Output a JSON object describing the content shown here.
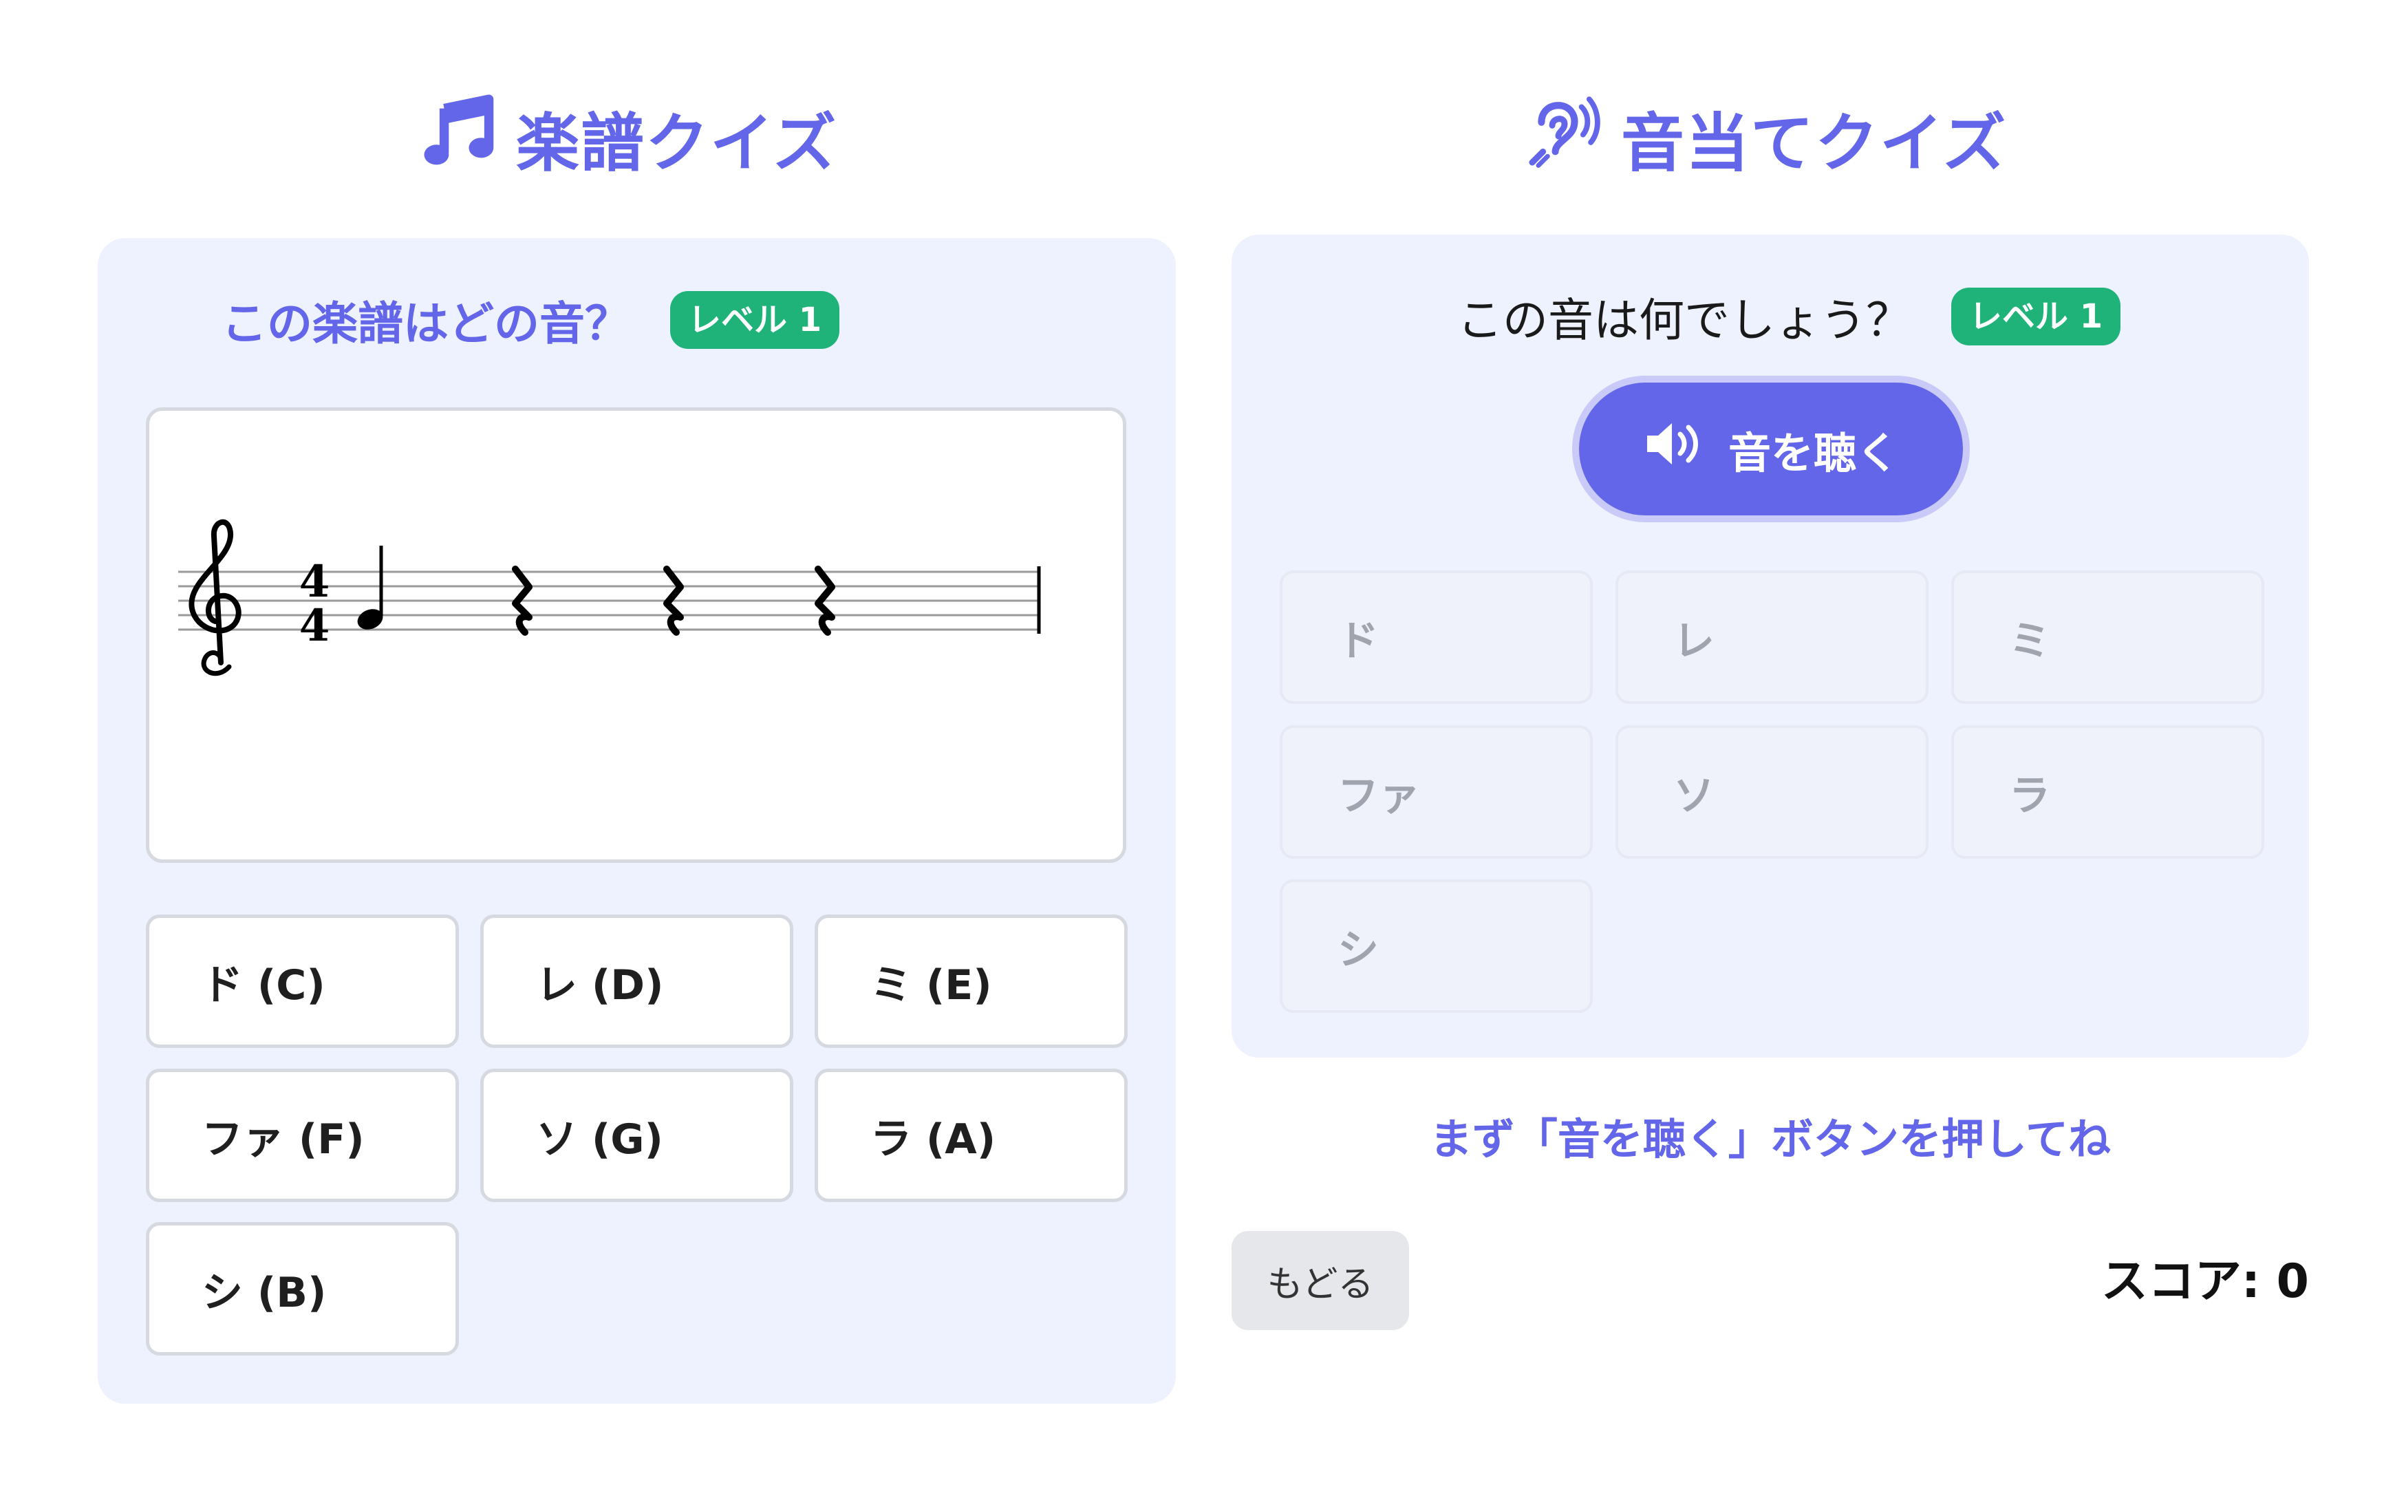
{
  "sheet_quiz": {
    "title": "楽譜クイズ",
    "question": "この楽譜はどの音？",
    "level": "レベル 1",
    "time_signature": {
      "top": "4",
      "bottom": "4"
    },
    "options": [
      "ド (C)",
      "レ (D)",
      "ミ (E)",
      "ファ (F)",
      "ソ (G)",
      "ラ (A)",
      "シ (B)"
    ]
  },
  "ear_quiz": {
    "title": "音当てクイズ",
    "question": "この音は何でしょう？",
    "level": "レベル 1",
    "listen_label": "音を聴く",
    "options": [
      "ド",
      "レ",
      "ミ",
      "ファ",
      "ソ",
      "ラ",
      "シ"
    ],
    "hint": "まず「音を聴く」ボタンを押してね"
  },
  "footer": {
    "back_label": "もどる",
    "score_text": "スコア: 0"
  },
  "colors": {
    "accent": "#6366e8",
    "level_badge": "#1fb37a",
    "panel_bg": "#eef1fe"
  },
  "icons": {
    "sheet_title": "music-note-icon",
    "ear_title": "ear-listen-icon",
    "listen": "speaker-icon"
  }
}
